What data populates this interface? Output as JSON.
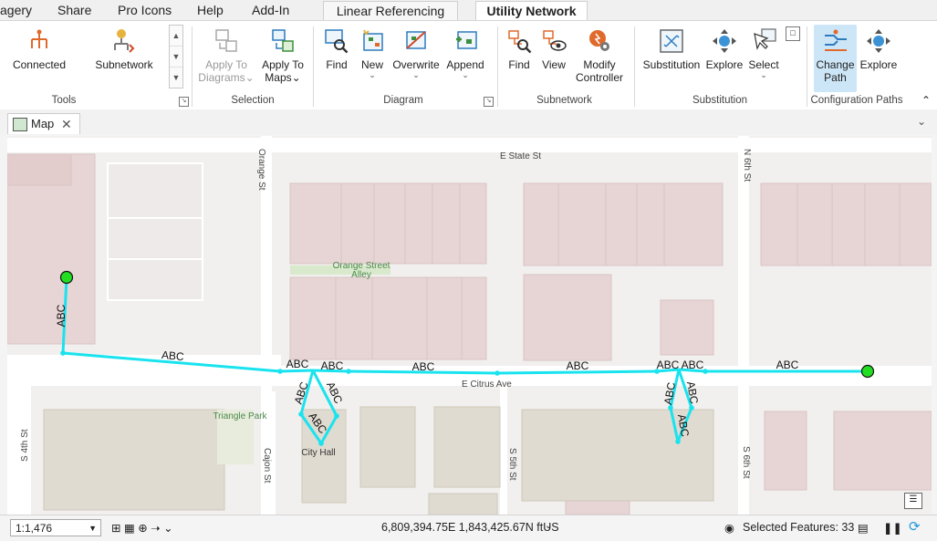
{
  "ribbon_tabs": [
    "agery",
    "Share",
    "Pro Icons",
    "Help",
    "Add-In",
    "Linear Referencing",
    "Utility Network"
  ],
  "accent": "#1f9ad8",
  "ribbon": {
    "tools": {
      "connected": "Connected",
      "subnetwork": "Subnetwork",
      "group": "Tools"
    },
    "selection": {
      "apply_diagrams": "Apply To",
      "apply_diagrams2": "Diagrams",
      "apply_maps": "Apply To",
      "apply_maps2": "Maps",
      "group": "Selection"
    },
    "diagram": {
      "find": "Find",
      "new": "New",
      "overwrite": "Overwrite",
      "append": "Append",
      "group": "Diagram"
    },
    "subnetwork": {
      "find": "Find",
      "view": "View",
      "modify": "Modify",
      "modify2": "Controller",
      "group": "Subnetwork"
    },
    "substitution": {
      "substitution": "Substitution",
      "explore": "Explore",
      "select": "Select",
      "group": "Substitution"
    },
    "config": {
      "change": "Change",
      "change2": "Path",
      "explore": "Explore",
      "group": "Configuration Paths"
    }
  },
  "view_tab": {
    "label": "Map"
  },
  "map": {
    "streets": [
      "E State St",
      "Orange St",
      "N 6th St",
      "E Citrus Ave",
      "S 4th St",
      "Cajon St",
      "S 5th St",
      "S 6th St"
    ],
    "places": [
      "Orange Street",
      "Alley",
      "Triangle Park",
      "City Hall"
    ],
    "line_label": "ABC",
    "trace_color": "#19e3ef",
    "endpoint_color": "#22dd22"
  },
  "status": {
    "scale": "1:1,476",
    "coords": "6,809,394.75E 1,843,425.67N ftUS",
    "selected": "Selected Features: 33"
  }
}
